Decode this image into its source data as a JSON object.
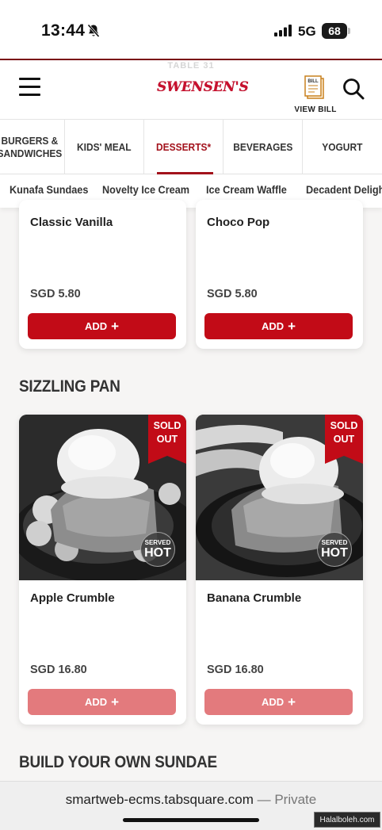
{
  "status_bar": {
    "time": "13:44",
    "network": "5G",
    "battery": "68"
  },
  "header": {
    "table_label": "TABLE 31",
    "brand": "SWENSEN'S",
    "view_bill_label": "VIEW BILL",
    "bill_icon_text": "BILL"
  },
  "categories": [
    {
      "label": "BURGERS & SANDWICHES"
    },
    {
      "label": "KIDS' MEAL"
    },
    {
      "label": "DESSERTS*",
      "active": true
    },
    {
      "label": "BEVERAGES"
    },
    {
      "label": "YOGURT"
    }
  ],
  "subcategories": [
    "Kunafa Sundaes",
    "Novelty Ice Cream",
    "Ice Cream Waffle",
    "Decadent Delight"
  ],
  "top_items": [
    {
      "name": "Classic Vanilla",
      "price": "SGD 5.80",
      "add_label": "ADD"
    },
    {
      "name": "Choco Pop",
      "price": "SGD 5.80",
      "add_label": "ADD"
    }
  ],
  "sections": {
    "sizzling_pan": "SIZZLING PAN",
    "build_your_own": "BUILD YOUR OWN SUNDAE"
  },
  "sizzling_items": [
    {
      "name": "Apple Crumble",
      "price": "SGD 16.80",
      "add_label": "ADD",
      "badge_line1": "SOLD",
      "badge_line2": "OUT",
      "served_label": "SERVED",
      "hot_label": "HOT"
    },
    {
      "name": "Banana Crumble",
      "price": "SGD 16.80",
      "add_label": "ADD",
      "badge_line1": "SOLD",
      "badge_line2": "OUT",
      "served_label": "SERVED",
      "hot_label": "HOT"
    }
  ],
  "browser": {
    "url": "smartweb-ecms.tabsquare.com",
    "separator": " — ",
    "mode": "Private"
  },
  "watermark": "Halalboleh.com",
  "colors": {
    "brand_red": "#c20b17",
    "active_tab": "#a3121c",
    "disabled_add": "#e37a7d"
  }
}
